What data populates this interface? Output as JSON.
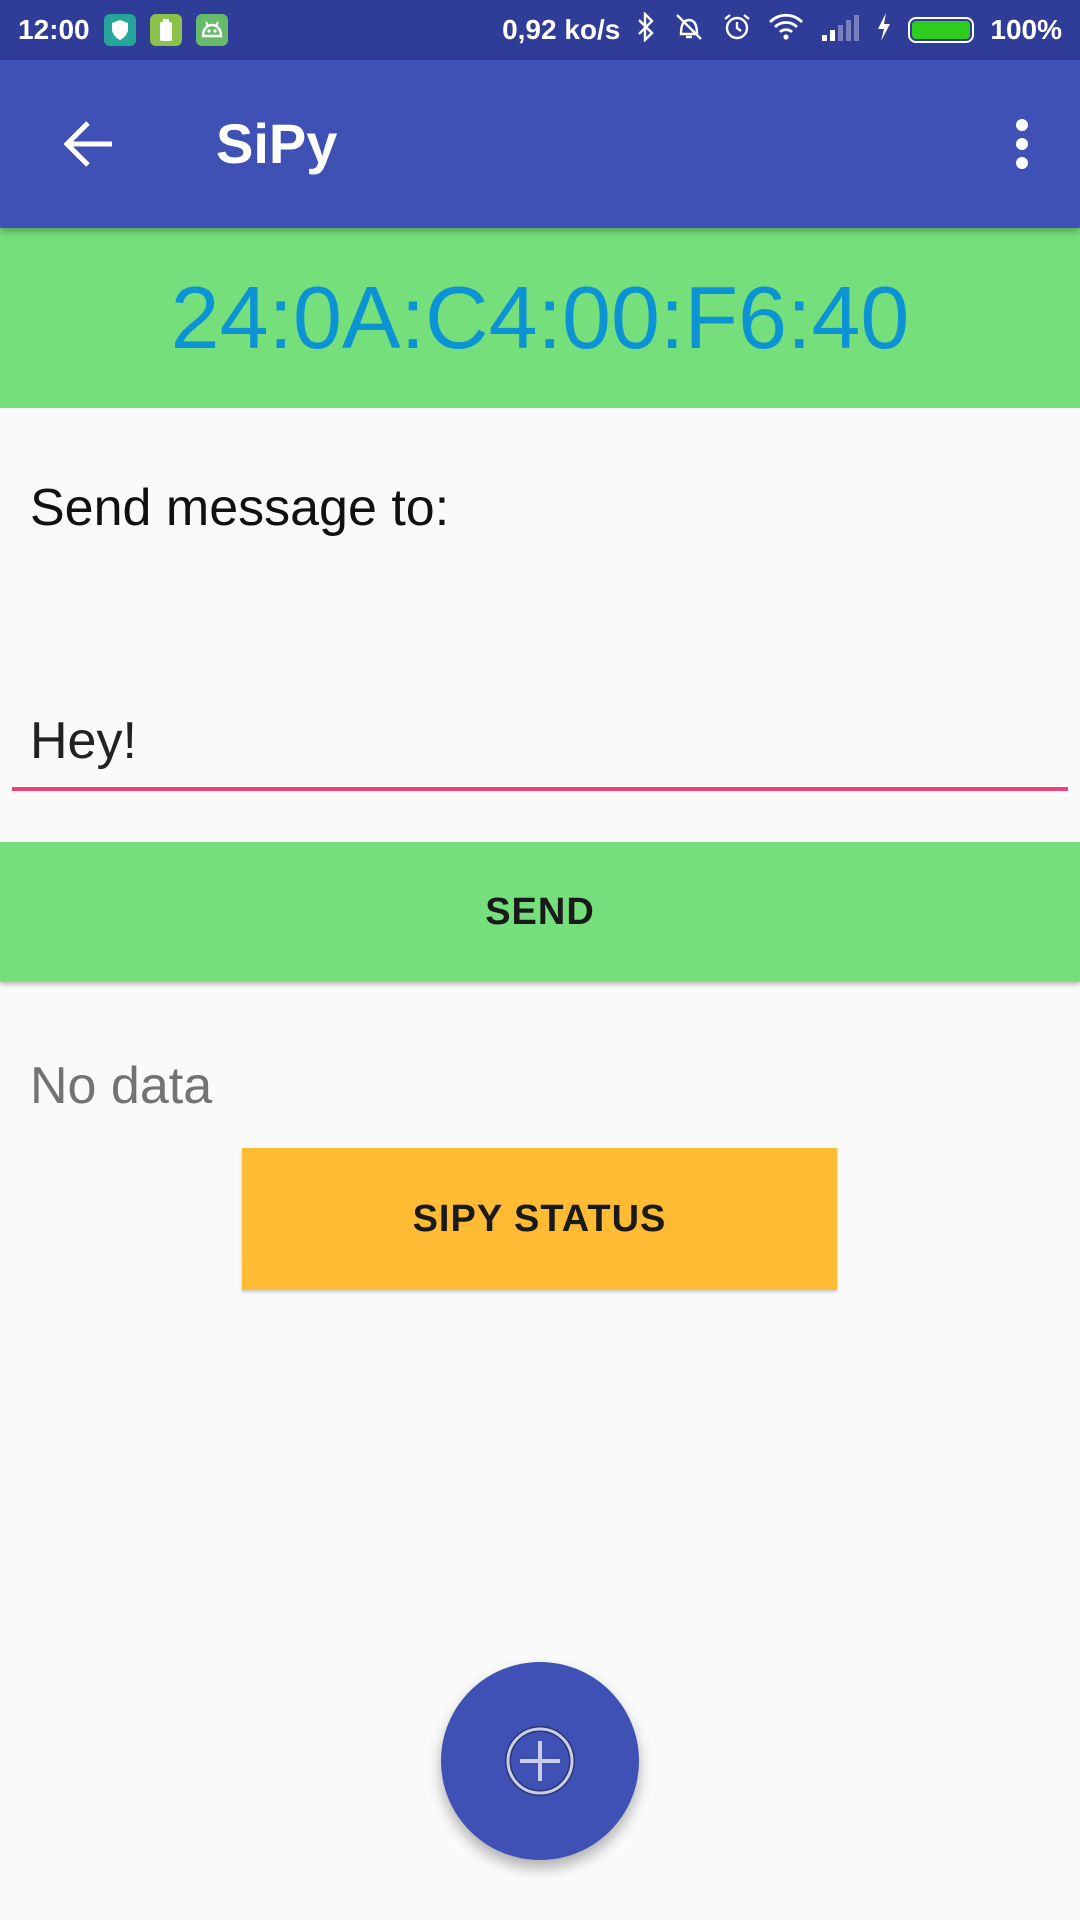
{
  "status_bar": {
    "time": "12:00",
    "net_speed": "0,92 ko/s",
    "battery_percent_label": "100%",
    "battery_level": 1.0,
    "notification_icons": [
      "shield-icon",
      "battery-saver-icon",
      "android-icon"
    ],
    "system_icons": [
      "bluetooth-icon",
      "vibrate-off-icon",
      "alarm-icon",
      "wifi-icon",
      "signal-icon",
      "charging-icon"
    ]
  },
  "app_bar": {
    "title": "SiPy",
    "back_icon": "arrow-back-icon",
    "menu_icon": "more-vert-icon"
  },
  "device": {
    "mac_address": "24:0A:C4:00:F6:40"
  },
  "form": {
    "send_label": "Send message to:",
    "message_value": "Hey!",
    "send_button": "SEND"
  },
  "status": {
    "no_data_text": "No data",
    "status_button": "SIPY STATUS"
  },
  "fab": {
    "icon": "add-circle-icon"
  },
  "colors": {
    "primary": "#3f51b5",
    "status_bar": "#2f3d99",
    "green": "#75e07b",
    "mac_text": "#0c93d4",
    "accent": "#f0437a",
    "amber": "#ffbb33"
  }
}
